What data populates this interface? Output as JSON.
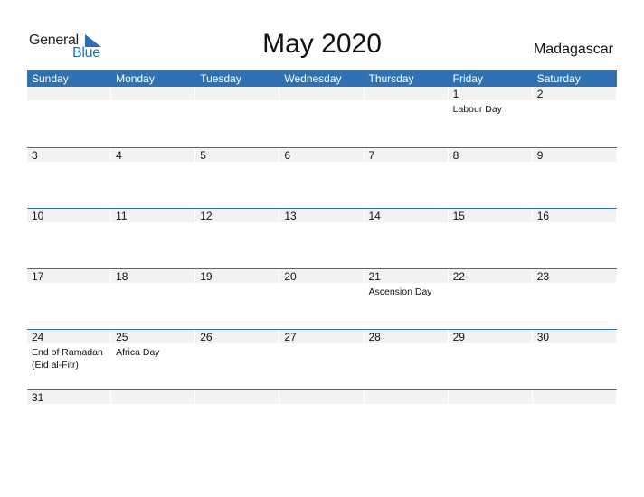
{
  "logo": {
    "general": "General",
    "blue": "Blue"
  },
  "title": "May 2020",
  "country": "Madagascar",
  "colors": {
    "accent": "#2e72b3",
    "strip": "#f2f2f2"
  },
  "weekdays": [
    "Sunday",
    "Monday",
    "Tuesday",
    "Wednesday",
    "Thursday",
    "Friday",
    "Saturday"
  ],
  "weeks": [
    [
      {
        "day": "",
        "event": ""
      },
      {
        "day": "",
        "event": ""
      },
      {
        "day": "",
        "event": ""
      },
      {
        "day": "",
        "event": ""
      },
      {
        "day": "",
        "event": ""
      },
      {
        "day": "1",
        "event": "Labour Day"
      },
      {
        "day": "2",
        "event": ""
      }
    ],
    [
      {
        "day": "3",
        "event": ""
      },
      {
        "day": "4",
        "event": ""
      },
      {
        "day": "5",
        "event": ""
      },
      {
        "day": "6",
        "event": ""
      },
      {
        "day": "7",
        "event": ""
      },
      {
        "day": "8",
        "event": ""
      },
      {
        "day": "9",
        "event": ""
      }
    ],
    [
      {
        "day": "10",
        "event": ""
      },
      {
        "day": "11",
        "event": ""
      },
      {
        "day": "12",
        "event": ""
      },
      {
        "day": "13",
        "event": ""
      },
      {
        "day": "14",
        "event": ""
      },
      {
        "day": "15",
        "event": ""
      },
      {
        "day": "16",
        "event": ""
      }
    ],
    [
      {
        "day": "17",
        "event": ""
      },
      {
        "day": "18",
        "event": ""
      },
      {
        "day": "19",
        "event": ""
      },
      {
        "day": "20",
        "event": ""
      },
      {
        "day": "21",
        "event": "Ascension Day"
      },
      {
        "day": "22",
        "event": ""
      },
      {
        "day": "23",
        "event": ""
      }
    ],
    [
      {
        "day": "24",
        "event": "End of Ramadan (Eid al-Fitr)"
      },
      {
        "day": "25",
        "event": "Africa Day"
      },
      {
        "day": "26",
        "event": ""
      },
      {
        "day": "27",
        "event": ""
      },
      {
        "day": "28",
        "event": ""
      },
      {
        "day": "29",
        "event": ""
      },
      {
        "day": "30",
        "event": ""
      }
    ],
    [
      {
        "day": "31",
        "event": ""
      },
      {
        "day": "",
        "event": ""
      },
      {
        "day": "",
        "event": ""
      },
      {
        "day": "",
        "event": ""
      },
      {
        "day": "",
        "event": ""
      },
      {
        "day": "",
        "event": ""
      },
      {
        "day": "",
        "event": ""
      }
    ]
  ]
}
